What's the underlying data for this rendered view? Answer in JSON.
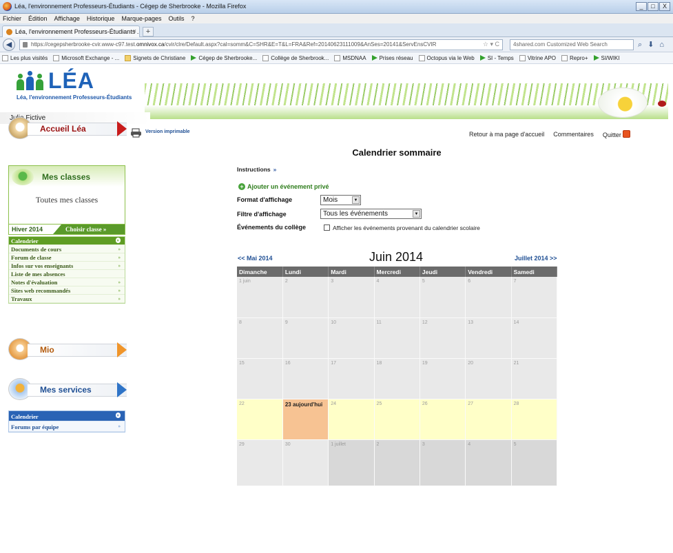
{
  "browser": {
    "window_title": "Léa, l'environnement Professeurs-Étudiants - Cégep de Sherbrooke - Mozilla Firefox",
    "window_buttons": [
      "_",
      "□",
      "X"
    ],
    "menu": [
      "Fichier",
      "Édition",
      "Affichage",
      "Historique",
      "Marque-pages",
      "Outils",
      "?"
    ],
    "tab_title": "Léa, l'environnement Professeurs-Étudiants ...",
    "new_tab": "+",
    "url_scheme": "https://cegepsherbrooke-cvir.www-c97.test.",
    "url_host": "omnivox.ca",
    "url_path": "/cvir/clre/Default.aspx?cal=somm&C=SHR&E=T&L=FRA&Ref=20140623111009&AnSes=20141&ServEnsCVIR",
    "url_tail": "☆ ▾ C",
    "search_placeholder": "4shared.com Customized Web Search",
    "bookmarks": [
      "Les plus visités",
      "Microsoft Exchange - ...",
      "Signets de Christiane",
      "Cégep de Sherbrooke...",
      "Collège de Sherbrook...",
      "MSDNAA",
      "Prises réseau",
      "Octopus via le Web",
      "SI - Temps",
      "Vitrine APO",
      "Repro+",
      "SI/WIKI"
    ]
  },
  "lea": {
    "logo": "LÉA",
    "tagline": "Léa, l'environnement Professeurs-Étudiants",
    "user_name": "Julie Fictive"
  },
  "sidebar": {
    "home_label": "Accueil Léa",
    "classes_label": "Mes classes",
    "all_classes": "Toutes mes classes",
    "season": "Hiver 2014",
    "choose_class": "Choisir classe »",
    "class_menu": [
      {
        "label": "Calendrier",
        "active": true
      },
      {
        "label": "Documents de cours",
        "active": false
      },
      {
        "label": "Forum de classe",
        "active": false
      },
      {
        "label": "Infos sur vos enseignants",
        "active": false
      },
      {
        "label": "Liste de mes absences",
        "active": false
      },
      {
        "label": "Notes d'évaluation",
        "active": false
      },
      {
        "label": "Sites web recommandés",
        "active": false
      },
      {
        "label": "Travaux",
        "active": false
      }
    ],
    "mio_label": "Mio",
    "services_label": "Mes services",
    "services_menu": [
      {
        "label": "Calendrier",
        "active": true
      },
      {
        "label": "Forums par équipe",
        "active": false
      }
    ]
  },
  "header_links": {
    "print": "Version imprimable",
    "home": "Retour à ma page d'accueil",
    "comments": "Commentaires",
    "quit": "Quitter"
  },
  "page": {
    "title": "Calendrier sommaire",
    "instructions": "Instructions",
    "add_event": "Ajouter un événement privé",
    "format_label": "Format d'affichage",
    "format_value": "Mois",
    "filter_label": "Filtre d'affichage",
    "filter_value": "Tous les événements",
    "college_label": "Événements du collège",
    "college_checkbox_label": "Afficher les événements provenant du calendrier scolaire"
  },
  "calendar": {
    "prev": "<< Mai 2014",
    "title": "Juin 2014",
    "next": "Juillet 2014 >>",
    "weekdays": [
      "Dimanche",
      "Lundi",
      "Mardi",
      "Mercredi",
      "Jeudi",
      "Vendredi",
      "Samedi"
    ],
    "weeks": [
      [
        "1 juin",
        "2",
        "3",
        "4",
        "5",
        "6",
        "7"
      ],
      [
        "8",
        "9",
        "10",
        "11",
        "12",
        "13",
        "14"
      ],
      [
        "15",
        "16",
        "17",
        "18",
        "19",
        "20",
        "21"
      ],
      [
        "22",
        "23 aujourd'hui",
        "24",
        "25",
        "26",
        "27",
        "28"
      ],
      [
        "29",
        "30",
        "1 juillet",
        "2",
        "3",
        "4",
        "5"
      ]
    ],
    "today_label": "23 aujourd'hui",
    "current_week_index": 3,
    "outside_cells": [
      [
        4,
        2
      ],
      [
        4,
        3
      ],
      [
        4,
        4
      ],
      [
        4,
        5
      ],
      [
        4,
        6
      ]
    ]
  },
  "colors": {
    "lea_blue": "#1e62b8",
    "classes_green": "#5f9d23",
    "services_blue": "#2a63b5",
    "home_red": "#c81b1b",
    "mio_orange": "#f0952a",
    "today": "#f7c393",
    "current_week": "#ffffc8"
  }
}
